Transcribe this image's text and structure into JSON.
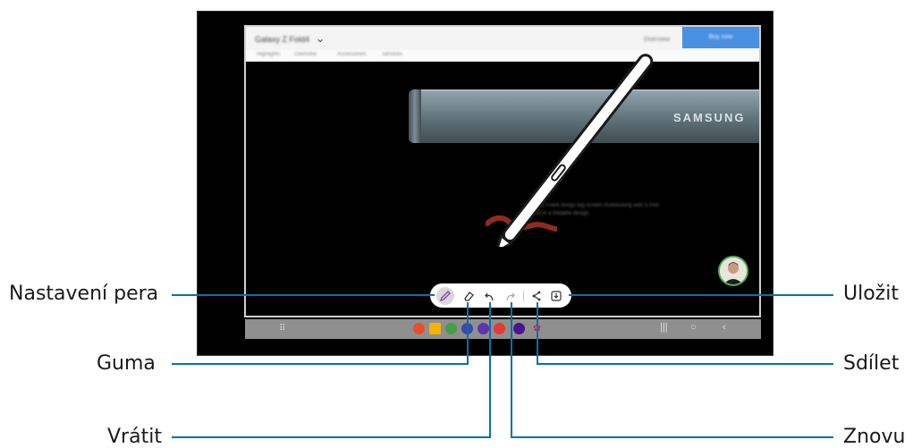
{
  "browser": {
    "title": "Galaxy Z Fold4",
    "mid_text": "Overview",
    "button_label": "Buy now",
    "tabs": [
      "Highlights",
      "Overview",
      "Accessories",
      "Services"
    ]
  },
  "product": {
    "brand_logo": "SAMSUNG",
    "promo_text": "Galaxy Z Fold4 brings big-screen multitasking with S Pen support in a foldable design."
  },
  "toolbar": {
    "buttons": [
      {
        "name": "pen-settings",
        "icon": "pen-icon"
      },
      {
        "name": "eraser",
        "icon": "eraser-icon"
      },
      {
        "name": "undo",
        "icon": "undo-icon"
      },
      {
        "name": "redo",
        "icon": "redo-icon"
      },
      {
        "name": "share",
        "icon": "share-icon"
      },
      {
        "name": "save",
        "icon": "save-icon"
      }
    ]
  },
  "callouts": {
    "pen_settings": "Nastavení pera",
    "eraser": "Guma",
    "undo": "Vrátit",
    "save": "Uložit",
    "share": "Sdílet",
    "redo": "Znovu"
  },
  "colors": {
    "leader_line": "#0b6fa8",
    "nav_bar": "#8f8f8f",
    "browser_button": "#4a90e2",
    "avatar_ring": "#4caf50"
  }
}
